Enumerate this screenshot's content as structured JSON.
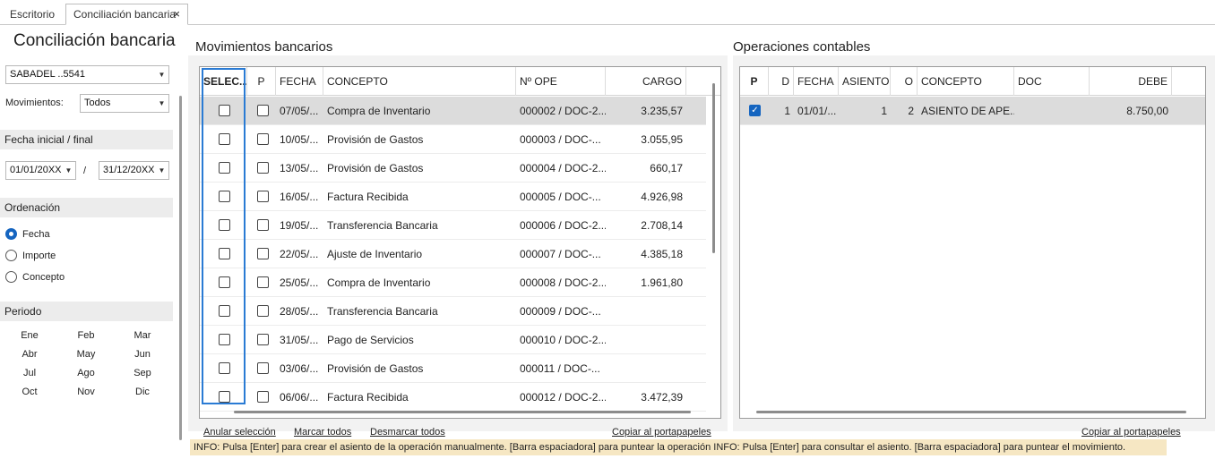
{
  "tabs": [
    {
      "label": "Escritorio"
    },
    {
      "label": "Conciliación bancaria",
      "close": "×"
    }
  ],
  "left": {
    "title": "Conciliación bancaria",
    "account": "SABADEL ..5541",
    "movements_label": "Movimientos:",
    "movements_value": "Todos",
    "date_section": "Fecha inicial / final",
    "date_from": "01/01/20XX",
    "date_sep": "/",
    "date_to": "31/12/20XX",
    "order_section": "Ordenación",
    "order_options": [
      {
        "label": "Fecha",
        "selected": true
      },
      {
        "label": "Importe",
        "selected": false
      },
      {
        "label": "Concepto",
        "selected": false
      }
    ],
    "period_section": "Periodo",
    "months": [
      "Ene",
      "Feb",
      "Mar",
      "Abr",
      "May",
      "Jun",
      "Jul",
      "Ago",
      "Sep",
      "Oct",
      "Nov",
      "Dic"
    ]
  },
  "bank": {
    "title": "Movimientos bancarios",
    "columns": [
      "SELEC...",
      "P",
      "FECHA",
      "CONCEPTO",
      "Nº OPE",
      "CARGO"
    ],
    "rows": [
      {
        "selec": false,
        "p": false,
        "fecha": "07/05/...",
        "concepto": "Compra de Inventario",
        "ope": "000002 / DOC-2...",
        "cargo": "3.235,57",
        "highlight": true
      },
      {
        "selec": false,
        "p": false,
        "fecha": "10/05/...",
        "concepto": "Provisión de Gastos",
        "ope": "000003 / DOC-...",
        "cargo": "3.055,95"
      },
      {
        "selec": false,
        "p": false,
        "fecha": "13/05/...",
        "concepto": "Provisión de Gastos",
        "ope": "000004 / DOC-2...",
        "cargo": "660,17"
      },
      {
        "selec": false,
        "p": false,
        "fecha": "16/05/...",
        "concepto": "Factura Recibida",
        "ope": "000005 / DOC-...",
        "cargo": "4.926,98"
      },
      {
        "selec": false,
        "p": false,
        "fecha": "19/05/...",
        "concepto": "Transferencia Bancaria",
        "ope": "000006 / DOC-2...",
        "cargo": "2.708,14"
      },
      {
        "selec": false,
        "p": false,
        "fecha": "22/05/...",
        "concepto": "Ajuste de Inventario",
        "ope": "000007 / DOC-...",
        "cargo": "4.385,18"
      },
      {
        "selec": false,
        "p": false,
        "fecha": "25/05/...",
        "concepto": "Compra de Inventario",
        "ope": "000008 / DOC-2...",
        "cargo": "1.961,80"
      },
      {
        "selec": false,
        "p": false,
        "fecha": "28/05/...",
        "concepto": "Transferencia Bancaria",
        "ope": "000009 / DOC-...",
        "cargo": ""
      },
      {
        "selec": false,
        "p": false,
        "fecha": "31/05/...",
        "concepto": "Pago de Servicios",
        "ope": "000010 / DOC-2...",
        "cargo": ""
      },
      {
        "selec": false,
        "p": false,
        "fecha": "03/06/...",
        "concepto": "Provisión de Gastos",
        "ope": "000011 / DOC-...",
        "cargo": ""
      },
      {
        "selec": false,
        "p": false,
        "fecha": "06/06/...",
        "concepto": "Factura Recibida",
        "ope": "000012 / DOC-2...",
        "cargo": "3.472,39"
      }
    ],
    "links": {
      "cancel": "Anular selección",
      "mark_all": "Marcar todos",
      "unmark_all": "Desmarcar todos",
      "copy": "Copiar al portapapeles"
    }
  },
  "ops": {
    "title": "Operaciones contables",
    "columns": [
      "P",
      "D",
      "FECHA",
      "ASIENTO",
      "O",
      "CONCEPTO",
      "DOC",
      "DEBE"
    ],
    "rows": [
      {
        "p": true,
        "d": "1",
        "fecha": "01/01/...",
        "asiento": "1",
        "o": "2",
        "concepto": "ASIENTO DE APE...",
        "doc": "",
        "debe": "8.750,00"
      }
    ],
    "links": {
      "copy": "Copiar al portapapeles"
    }
  },
  "info": "INFO: Pulsa [Enter] para crear el asiento de la operación manualmente. [Barra espaciadora] para puntear la operación INFO: Pulsa [Enter] para consultar el asiento. [Barra espaciadora] para puntear el movimiento.",
  "colors": {
    "accent": "#1565c0",
    "selected_row": "#dcdcdc",
    "info_bg": "#f6e7c3"
  }
}
